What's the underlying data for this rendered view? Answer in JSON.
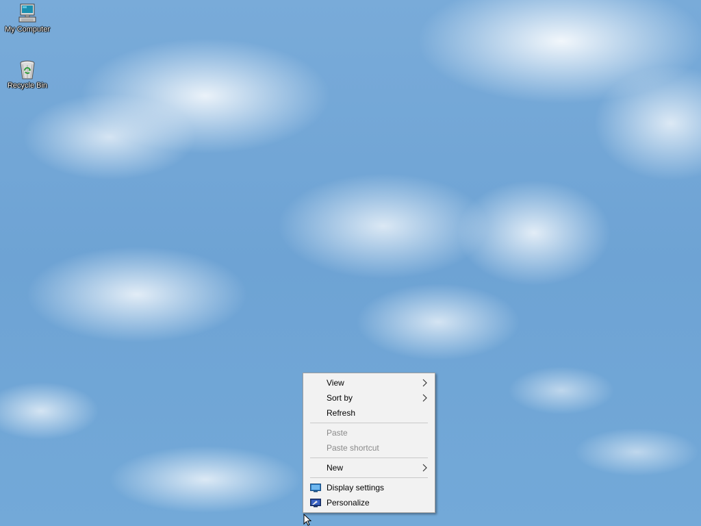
{
  "desktop": {
    "icons": [
      {
        "label": "My Computer",
        "icon": "computer-icon"
      },
      {
        "label": "Recycle Bin",
        "icon": "recycle-bin-icon"
      }
    ]
  },
  "context_menu": {
    "items": [
      {
        "label": "View",
        "has_submenu": true,
        "enabled": true
      },
      {
        "label": "Sort by",
        "has_submenu": true,
        "enabled": true
      },
      {
        "label": "Refresh",
        "has_submenu": false,
        "enabled": true
      },
      {
        "label": "Paste",
        "has_submenu": false,
        "enabled": false
      },
      {
        "label": "Paste shortcut",
        "has_submenu": false,
        "enabled": false
      },
      {
        "label": "New",
        "has_submenu": true,
        "enabled": true
      },
      {
        "label": "Display settings",
        "icon": "display-icon",
        "enabled": true
      },
      {
        "label": "Personalize",
        "icon": "personalize-icon",
        "enabled": true
      }
    ]
  },
  "colors": {
    "menu_background": "#f2f2f2",
    "disabled_text": "#8a8a8a",
    "desktop_sky": "#6fa6d6"
  }
}
